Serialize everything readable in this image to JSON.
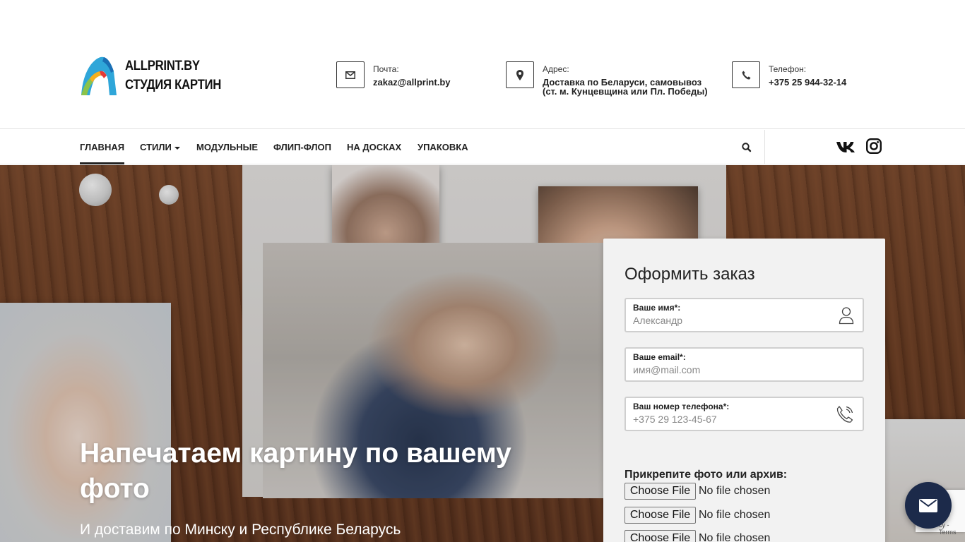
{
  "brand": {
    "line1": "ALLPRINT.BY",
    "line2": "СТУДИЯ КАРТИН"
  },
  "contacts": {
    "mail": {
      "label": "Почта:",
      "value": "zakaz@allprint.by",
      "icon": "envelope-icon"
    },
    "address": {
      "label": "Адрес:",
      "value_line1": "Доставка по Беларуси, самовывоз",
      "value_line2": "(ст. м. Кунцевщина или Пл. Победы)",
      "icon": "map-marker-icon"
    },
    "phone": {
      "label": "Телефон:",
      "value": "+375 25 944-32-14",
      "icon": "phone-icon"
    }
  },
  "nav": {
    "items": [
      {
        "label": "ГЛАВНАЯ",
        "active": true
      },
      {
        "label": "СТИЛИ",
        "dropdown": true
      },
      {
        "label": "МОДУЛЬНЫЕ"
      },
      {
        "label": "ФЛИП-ФЛОП"
      },
      {
        "label": "НА ДОСКАХ"
      },
      {
        "label": "УПАКОВКА"
      }
    ],
    "icons": [
      "search-icon",
      "vk-icon",
      "instagram-icon"
    ]
  },
  "hero": {
    "title": "Напечатаем картину по вашему фото",
    "subtitle": "И доставим по Минску и Республике Беларусь"
  },
  "order_form": {
    "title": "Оформить заказ",
    "name": {
      "label": "Ваше имя*:",
      "placeholder": "Александр",
      "icon": "user-icon"
    },
    "email": {
      "label": "Ваше email*:",
      "placeholder": "имя@mail.com"
    },
    "phone": {
      "label": "Ваш номер телефона*:",
      "placeholder": "+375 29 123-45-67",
      "icon": "phone-call-icon"
    },
    "attach_label": "Прикрепите фото или архив:",
    "files": [
      {
        "button": "Choose File",
        "status": "No file chosen"
      },
      {
        "button": "Choose File",
        "status": "No file chosen"
      },
      {
        "button": "Choose File",
        "status": "No file chosen"
      }
    ]
  },
  "recaptcha": {
    "terms": "cy - Terms"
  },
  "colors": {
    "fab": "#1c2a4a",
    "wood": "#6b3e24",
    "form_bg": "#f2f2f2"
  }
}
